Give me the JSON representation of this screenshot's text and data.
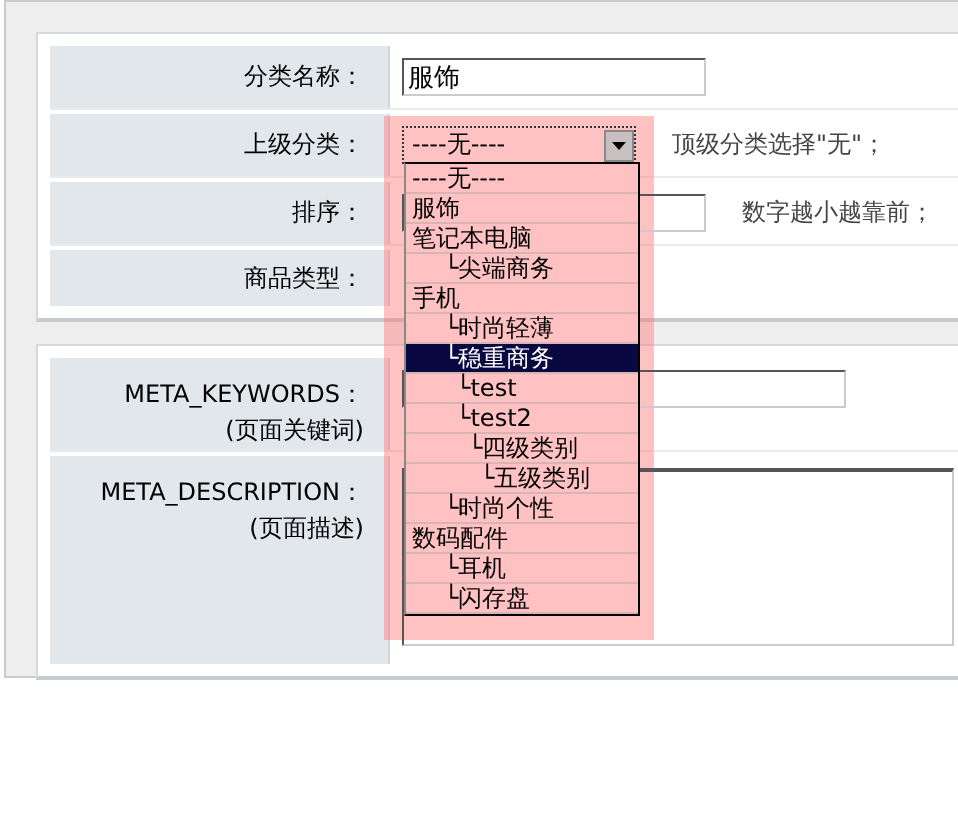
{
  "basic_form": {
    "rows": [
      {
        "kind": "text",
        "label": "分类名称：",
        "value": "服饰"
      },
      {
        "kind": "select",
        "label": "上级分类：",
        "hint": "顶级分类选择\"无\"；"
      },
      {
        "kind": "number",
        "label": "排序：",
        "hint": "数字越小越靠前；"
      },
      {
        "kind": "plain",
        "label": "商品类型："
      }
    ]
  },
  "parent_select": {
    "value": "----无----",
    "options": [
      {
        "label": "----无----",
        "highlighted": false
      },
      {
        "label": "服饰",
        "highlighted": false
      },
      {
        "label": "笔记本电脑",
        "highlighted": false,
        "children": [
          {
            "label": "└尖端商务",
            "highlighted": false
          }
        ]
      },
      {
        "label": "手机",
        "highlighted": false,
        "children": [
          {
            "label": "└时尚轻薄",
            "highlighted": false
          },
          {
            "label": "└稳重商务",
            "highlighted": true,
            "children": [
              {
                "label": "└test",
                "highlighted": false
              },
              {
                "label": "└test2",
                "highlighted": false,
                "children": [
                  {
                    "label": "└四级类别",
                    "highlighted": false,
                    "children": [
                      {
                        "label": "└五级类别",
                        "highlighted": false
                      }
                    ]
                  }
                ]
              }
            ]
          },
          {
            "label": "└时尚个性",
            "highlighted": false
          }
        ]
      },
      {
        "label": "数码配件",
        "highlighted": false,
        "children": [
          {
            "label": "└耳机",
            "highlighted": false
          },
          {
            "label": "└闪存盘",
            "highlighted": false
          }
        ]
      }
    ]
  },
  "seo_form": {
    "rows": [
      {
        "kind": "input",
        "label": "META_KEYWORDS：",
        "sublabel": "(页面关键词)"
      },
      {
        "kind": "textarea",
        "label": "META_DESCRIPTION：",
        "sublabel": "(页面描述)"
      }
    ]
  }
}
